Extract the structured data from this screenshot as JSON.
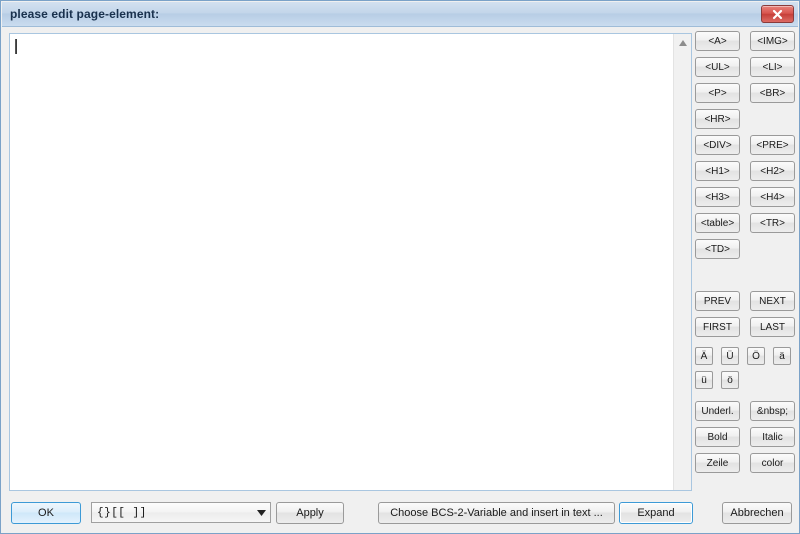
{
  "window": {
    "title": "please edit page-element:",
    "close_icon": "close-icon",
    "accent_color": "#3d9ad6",
    "titlebar_color": "#c3d6ea",
    "close_button_color": "#c63f39"
  },
  "editor": {
    "content": "",
    "caret_visible": true,
    "scrollbar": {
      "up_arrow_icon": "triangle-up-icon",
      "down_arrow_icon": "triangle-down-icon"
    }
  },
  "side_panel": {
    "tag_buttons": [
      {
        "label": "<A>"
      },
      {
        "label": "<IMG>"
      },
      {
        "label": "<UL>"
      },
      {
        "label": "<LI>"
      },
      {
        "label": "<P>"
      },
      {
        "label": "<BR>"
      },
      {
        "label": "<HR>"
      },
      {
        "label": ""
      },
      {
        "label": "<DIV>"
      },
      {
        "label": "<PRE>"
      },
      {
        "label": "<H1>"
      },
      {
        "label": "<H2>"
      },
      {
        "label": "<H3>"
      },
      {
        "label": "<H4>"
      },
      {
        "label": "<table>"
      },
      {
        "label": "<TR>"
      },
      {
        "label": "<TD>"
      }
    ],
    "nav_buttons": [
      {
        "label": "PREV"
      },
      {
        "label": "NEXT"
      },
      {
        "label": "FIRST"
      },
      {
        "label": "LAST"
      }
    ],
    "char_buttons": [
      {
        "label": "Ä"
      },
      {
        "label": "Ü"
      },
      {
        "label": "Ö"
      },
      {
        "label": "ä"
      },
      {
        "label": "ü"
      },
      {
        "label": "ö"
      }
    ],
    "format_buttons": [
      {
        "label": "Underl."
      },
      {
        "label": "&nbsp;"
      },
      {
        "label": "Bold"
      },
      {
        "label": "Italic"
      },
      {
        "label": "Zeile"
      },
      {
        "label": "color"
      }
    ]
  },
  "bottom_bar": {
    "ok_label": "OK",
    "variable_combo": {
      "value": "{}[[   ]]",
      "arrow_icon": "chevron-down-icon"
    },
    "apply_label": "Apply",
    "choose_variable_label": "Choose BCS-2-Variable and insert in text ...",
    "expand_label": "Expand",
    "cancel_label": "Abbrechen"
  }
}
